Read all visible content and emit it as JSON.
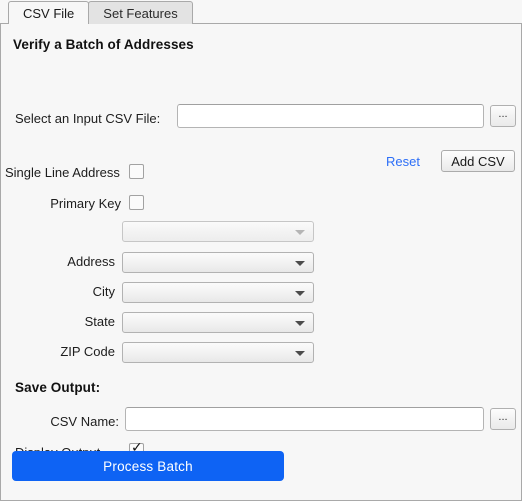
{
  "tabs": [
    {
      "label": "CSV File",
      "active": true
    },
    {
      "label": "Set Features",
      "active": false
    }
  ],
  "heading": "Verify a Batch of Addresses",
  "input_section": {
    "file_label": "Select an Input CSV File:",
    "file_value": "",
    "file_placeholder": "",
    "browse_label": "...",
    "reset_label": "Reset",
    "add_csv_label": "Add CSV"
  },
  "options": {
    "single_line_address_label": "Single Line Address",
    "single_line_address_checked": false,
    "primary_key_label": "Primary Key",
    "primary_key_checked": false
  },
  "field_mapping": [
    {
      "label": "",
      "value": "",
      "disabled": true
    },
    {
      "label": "Address",
      "value": "",
      "disabled": false
    },
    {
      "label": "City",
      "value": "",
      "disabled": false
    },
    {
      "label": "State",
      "value": "",
      "disabled": false
    },
    {
      "label": "ZIP Code",
      "value": "",
      "disabled": false
    }
  ],
  "save_output": {
    "title": "Save Output:",
    "csv_name_label": "CSV Name:",
    "csv_name_value": "",
    "csv_name_placeholder": "",
    "browse_label": "...",
    "display_output_label": "Display Output",
    "display_output_checked": true
  },
  "action": {
    "process_batch_label": "Process Batch",
    "accent_color": "#0e63f4"
  }
}
